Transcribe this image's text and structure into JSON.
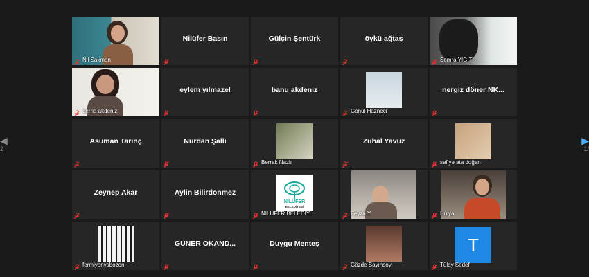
{
  "pager": {
    "left_label": "2",
    "right_label": "1/"
  },
  "accent": {
    "active_border": "#d9e86a",
    "avatar_bg": "#1e88e5",
    "mic_muted": "#e03131"
  },
  "participants": [
    {
      "name": "Nil Sakman",
      "kind": "video"
    },
    {
      "name": "Nilüfer Basın",
      "kind": "name"
    },
    {
      "name": "Gülçin Şentürk",
      "kind": "name"
    },
    {
      "name": "öykü ağtaş",
      "kind": "name"
    },
    {
      "name": "Semra YİĞİT",
      "kind": "video"
    },
    {
      "name": "berna akdeniz",
      "kind": "video"
    },
    {
      "name": "eylem yılmazel",
      "kind": "name"
    },
    {
      "name": "banu akdeniz",
      "kind": "name"
    },
    {
      "name": "Gönül Hazneci",
      "kind": "picture"
    },
    {
      "name": "nergiz döner NK...",
      "kind": "name"
    },
    {
      "name": "Asuman Tarınç",
      "kind": "name"
    },
    {
      "name": "Nurdan Şallı",
      "kind": "name"
    },
    {
      "name": "Berrak Nazlı",
      "kind": "picture"
    },
    {
      "name": "Zuhal Yavuz",
      "kind": "name"
    },
    {
      "name": "safiye ata doğan",
      "kind": "picture"
    },
    {
      "name": "Zeynep Akar",
      "kind": "name"
    },
    {
      "name": "Aylin Bilirdönmez",
      "kind": "name"
    },
    {
      "name": "NİLÜFER BELEDİY...",
      "kind": "logo",
      "logo_text": "NİLÜFER",
      "logo_sub": "BELEDİYESİ"
    },
    {
      "name": "Feyza Y",
      "kind": "video"
    },
    {
      "name": "Hülya",
      "kind": "video"
    },
    {
      "name": "fermiyonvsbozon",
      "kind": "picture"
    },
    {
      "name": "GÜNER OKAND...",
      "kind": "name"
    },
    {
      "name": "Duygu Menteş",
      "kind": "name"
    },
    {
      "name": "Gözde Sayınsoy",
      "kind": "picture"
    },
    {
      "name": "Tülay Sedef",
      "kind": "avatar",
      "initial": "T"
    }
  ]
}
